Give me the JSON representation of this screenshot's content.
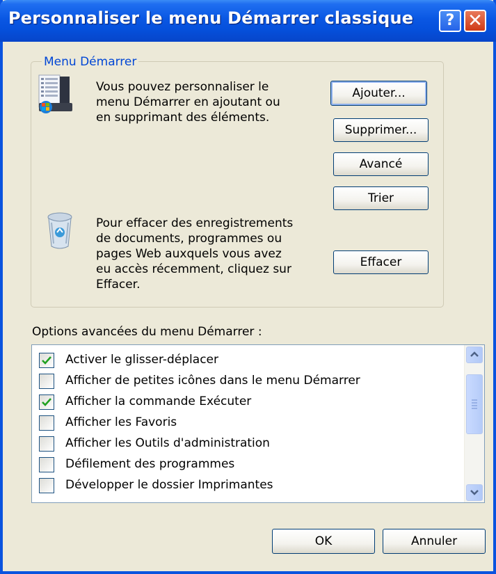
{
  "window": {
    "title": "Personnaliser le menu Démarrer classique"
  },
  "start_menu_group": {
    "legend": "Menu Démarrer",
    "description_lines": [
      "Vous pouvez personnaliser le",
      "menu Démarrer en ajoutant ou",
      "en supprimant des éléments."
    ],
    "clear_lines": [
      "Pour effacer des enregistrements",
      "de documents, programmes ou",
      "pages Web auxquels vous avez",
      "eu accès récemment, cliquez sur",
      "Effacer."
    ],
    "buttons": {
      "add": "Ajouter...",
      "remove": "Supprimer...",
      "advanced": "Avancé",
      "sort": "Trier",
      "clear": "Effacer"
    }
  },
  "options": {
    "label": "Options avancées du menu Démarrer :",
    "items": [
      {
        "label": "Activer le glisser-déplacer",
        "checked": true
      },
      {
        "label": "Afficher de petites icônes dans le menu Démarrer",
        "checked": false
      },
      {
        "label": "Afficher la commande Exécuter",
        "checked": true
      },
      {
        "label": "Afficher les Favoris",
        "checked": false
      },
      {
        "label": "Afficher les Outils d'administration",
        "checked": false
      },
      {
        "label": "Défilement des programmes",
        "checked": false
      },
      {
        "label": "Développer le dossier Imprimantes",
        "checked": false
      }
    ]
  },
  "footer": {
    "ok": "OK",
    "cancel": "Annuler"
  },
  "colors": {
    "titlebar": "#0a57e3",
    "legend": "#0046d5",
    "checkmark": "#21a121",
    "window_bg": "#ece9d8"
  }
}
